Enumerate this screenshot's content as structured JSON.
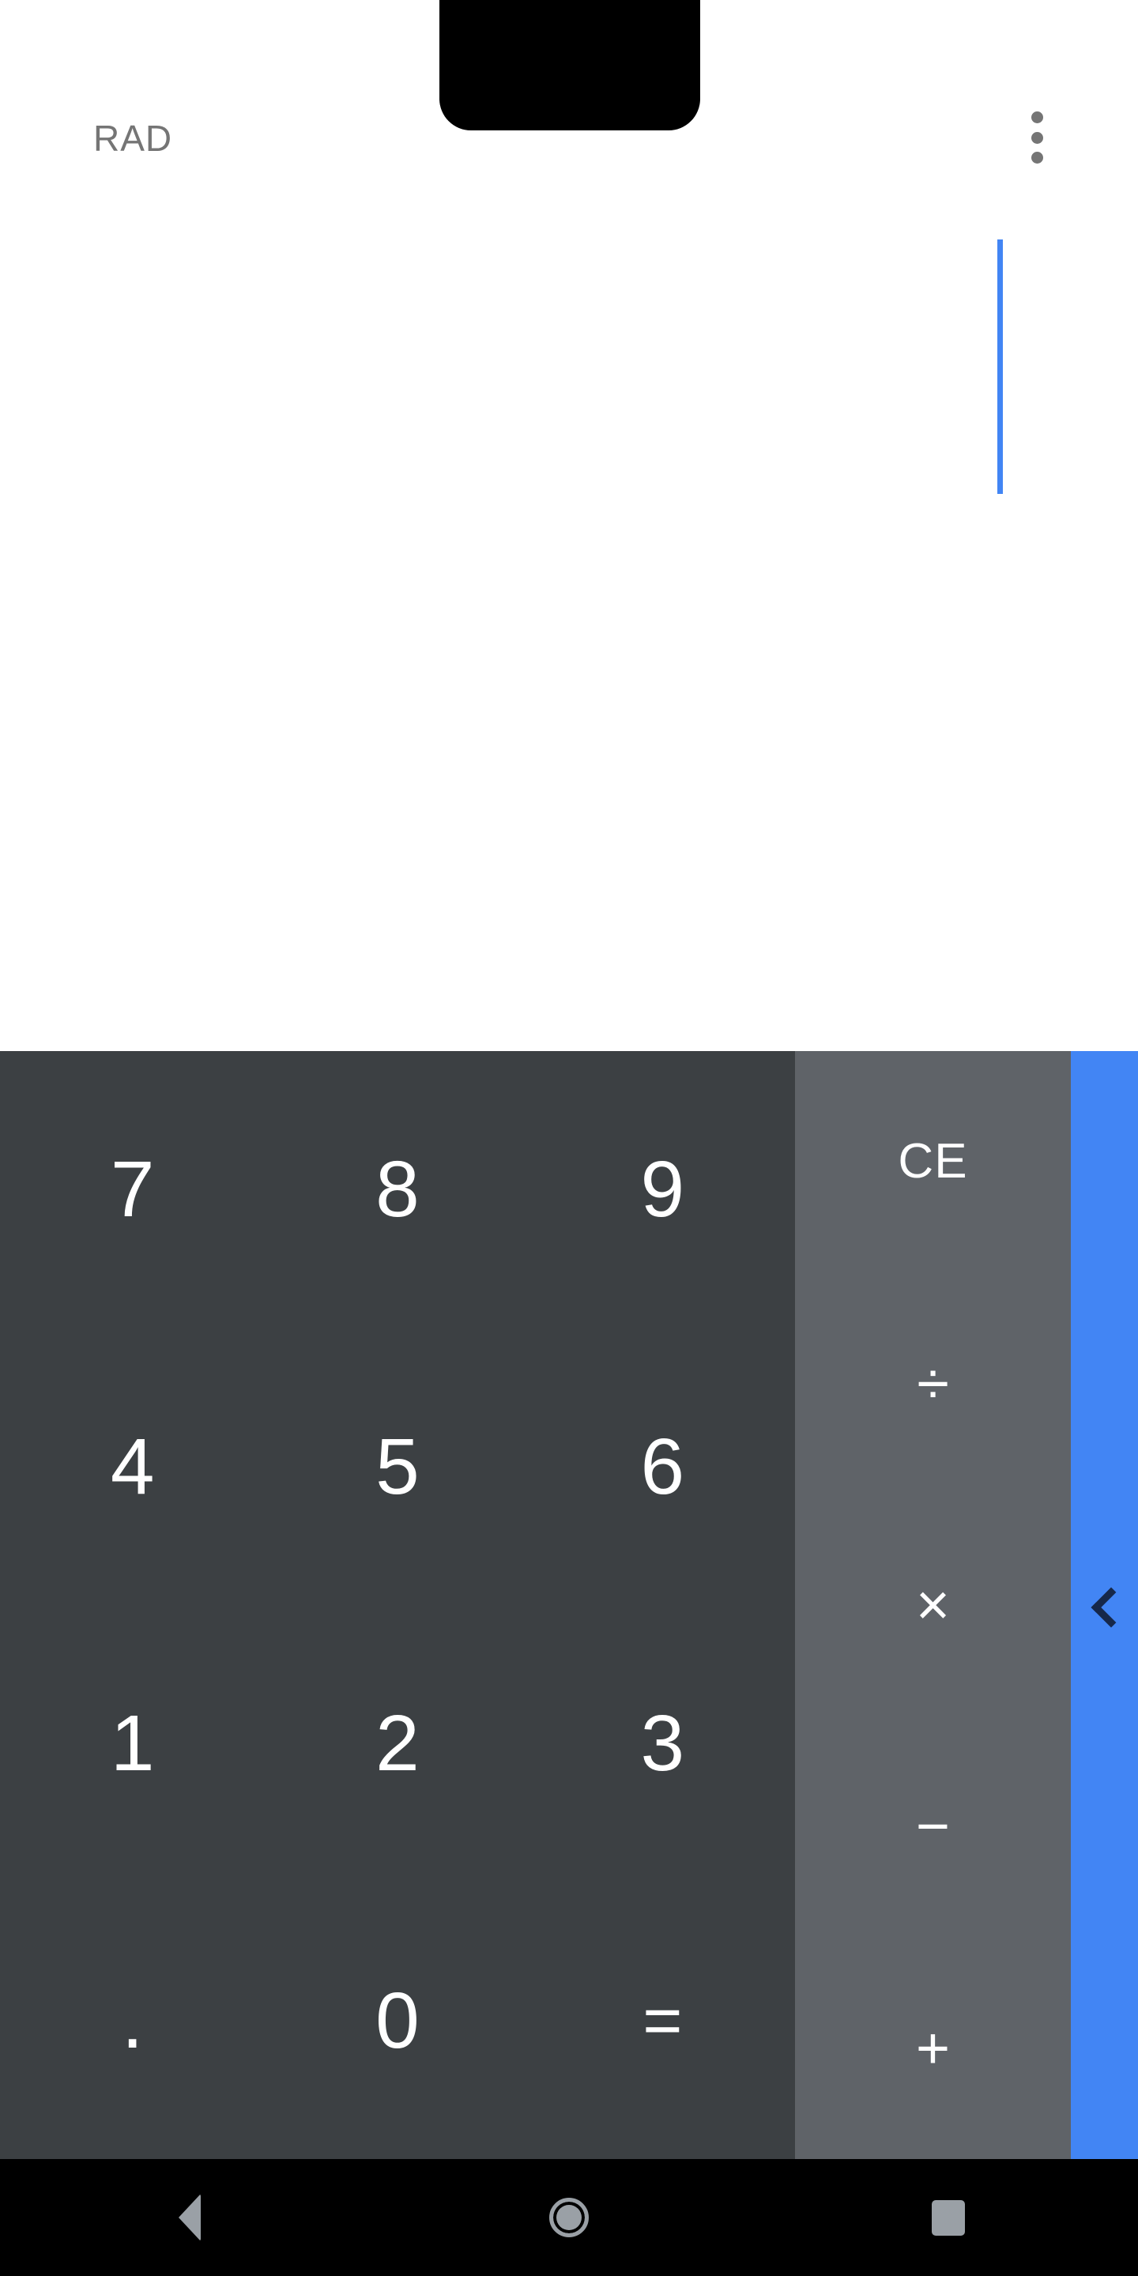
{
  "app": {
    "name": "Calculator",
    "platform": "android"
  },
  "statusbar": {
    "notch": "camera-notch"
  },
  "display": {
    "angle_mode_label": "RAD",
    "formula": "",
    "result": "",
    "cursor_visible": true,
    "overflow_menu_label": "More options"
  },
  "colors": {
    "display_bg": "#ffffff",
    "numpad_bg": "#3C4043",
    "operator_bg": "#5F6368",
    "accent_blue": "#4285F4",
    "cursor": "#4285F4",
    "key_text": "#ffffff",
    "rad_text": "#757575",
    "nav_icon": "#9AA0A6",
    "navbar_bg": "#000000",
    "chevron": "#16284a"
  },
  "keypad": {
    "numeric_rows": [
      [
        {
          "label": "7",
          "name": "key-7",
          "kind": "digit"
        },
        {
          "label": "8",
          "name": "key-8",
          "kind": "digit"
        },
        {
          "label": "9",
          "name": "key-9",
          "kind": "digit"
        }
      ],
      [
        {
          "label": "4",
          "name": "key-4",
          "kind": "digit"
        },
        {
          "label": "5",
          "name": "key-5",
          "kind": "digit"
        },
        {
          "label": "6",
          "name": "key-6",
          "kind": "digit"
        }
      ],
      [
        {
          "label": "1",
          "name": "key-1",
          "kind": "digit"
        },
        {
          "label": "2",
          "name": "key-2",
          "kind": "digit"
        },
        {
          "label": "3",
          "name": "key-3",
          "kind": "digit"
        }
      ],
      [
        {
          "label": ".",
          "name": "key-decimal-point",
          "kind": "dot"
        },
        {
          "label": "0",
          "name": "key-0",
          "kind": "digit"
        },
        {
          "label": "=",
          "name": "key-equals",
          "kind": "equals"
        }
      ]
    ],
    "operators": [
      {
        "label": "CE",
        "name": "key-clear-entry",
        "kind": "ce"
      },
      {
        "label": "÷",
        "name": "key-divide",
        "kind": "sym"
      },
      {
        "label": "×",
        "name": "key-multiply",
        "kind": "sym"
      },
      {
        "label": "−",
        "name": "key-subtract",
        "kind": "sym"
      },
      {
        "label": "+",
        "name": "key-add",
        "kind": "sym"
      }
    ],
    "panel_toggle": {
      "icon": "chevron-left-icon",
      "label": "Open advanced pad"
    }
  },
  "navbar": {
    "items": [
      {
        "name": "nav-back-button",
        "icon": "back-triangle-icon",
        "label": "Back"
      },
      {
        "name": "nav-home-button",
        "icon": "home-circle-icon",
        "label": "Home"
      },
      {
        "name": "nav-recents-button",
        "icon": "recents-square-icon",
        "label": "Recents"
      }
    ]
  }
}
